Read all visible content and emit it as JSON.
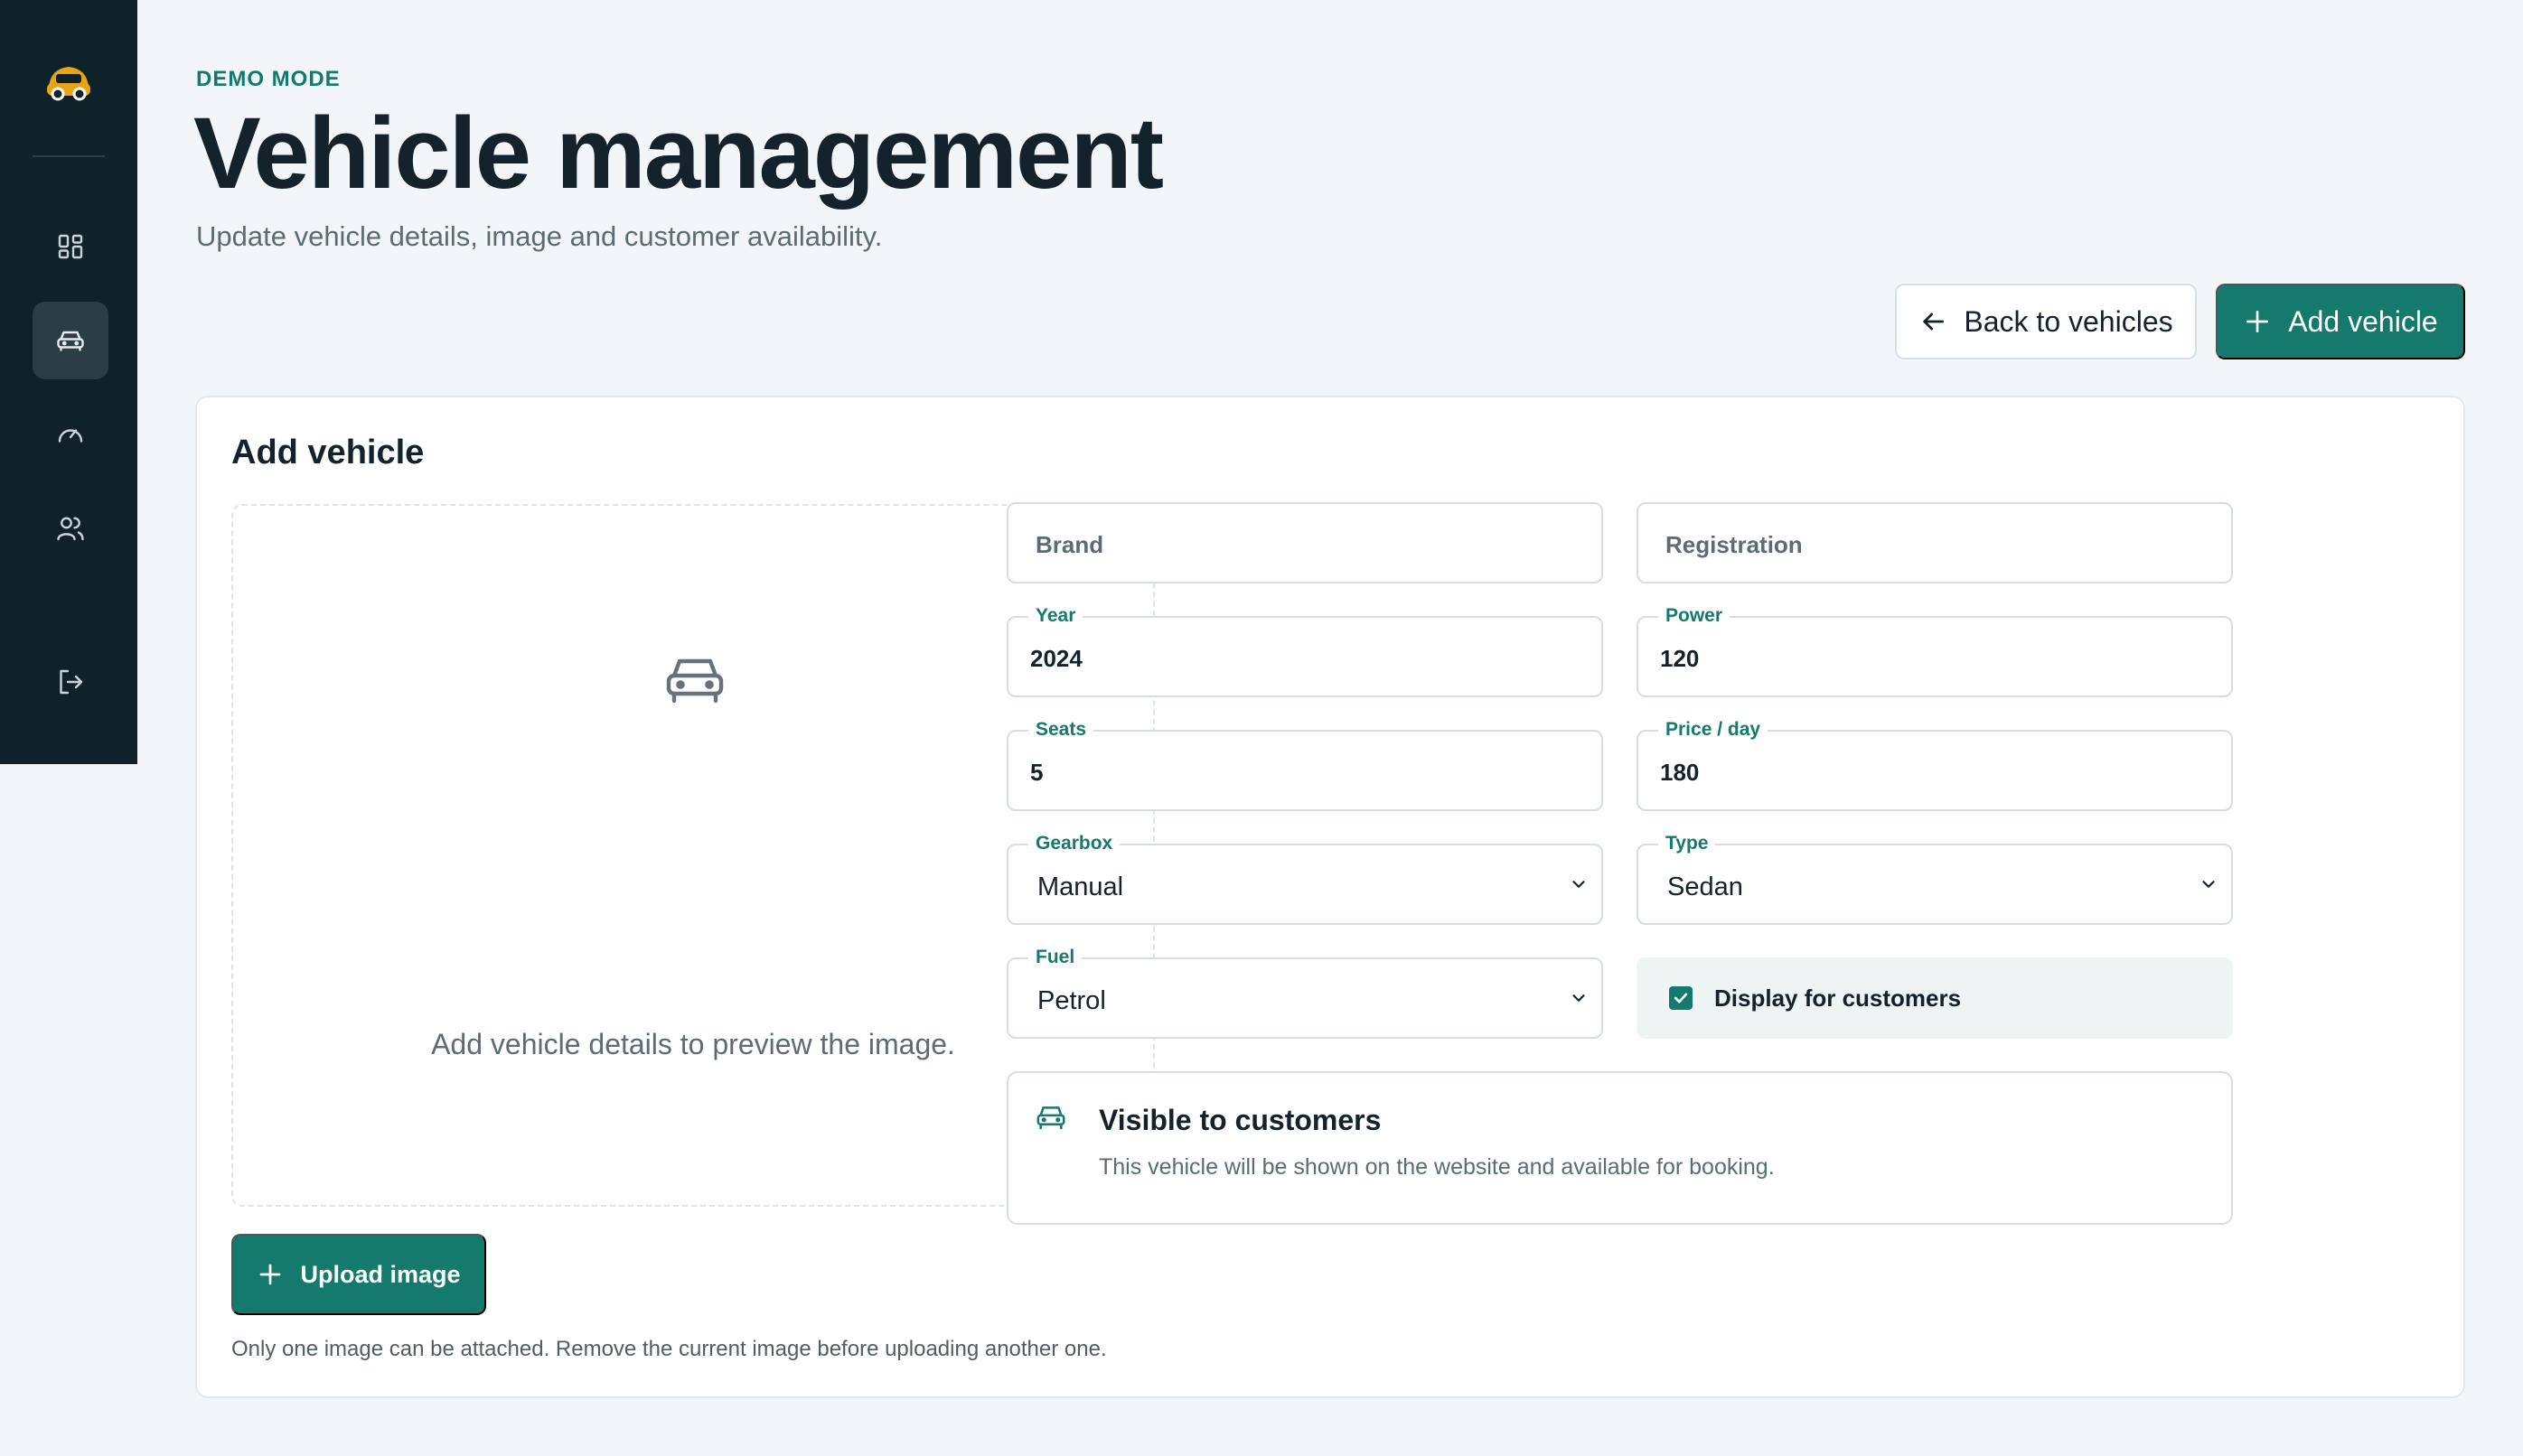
{
  "header": {
    "eyebrow": "DEMO MODE",
    "title": "Vehicle management",
    "subtitle": "Update vehicle details, image and customer availability."
  },
  "sidebar": {
    "items": [
      {
        "icon": "dashboard-icon",
        "active": false
      },
      {
        "icon": "car-icon",
        "active": true
      },
      {
        "icon": "gauge-icon",
        "active": false
      },
      {
        "icon": "users-icon",
        "active": false
      },
      {
        "icon": "logout-icon",
        "active": false
      }
    ]
  },
  "actions": {
    "back_label": "Back to vehicles",
    "add_label": "Add vehicle"
  },
  "form": {
    "title": "Add vehicle",
    "preview_text": "Add vehicle details to preview the image.",
    "upload_label": "Upload image",
    "upload_note": "Only one image can be attached. Remove the current image before uploading another one.",
    "brand": {
      "placeholder": "Brand",
      "value": ""
    },
    "registration": {
      "placeholder": "Registration",
      "value": ""
    },
    "year": {
      "label": "Year",
      "value": "2024"
    },
    "power": {
      "label": "Power",
      "value": "120"
    },
    "seats": {
      "label": "Seats",
      "value": "5"
    },
    "price": {
      "label": "Price / day",
      "value": "180"
    },
    "gearbox": {
      "label": "Gearbox",
      "value": "Manual"
    },
    "type": {
      "label": "Type",
      "value": "Sedan"
    },
    "fuel": {
      "label": "Fuel",
      "value": "Petrol"
    },
    "display_customers": {
      "label": "Display for customers",
      "checked": true
    },
    "visibility": {
      "title": "Visible to customers",
      "description": "This vehicle will be shown on the website and available for booking."
    }
  },
  "colors": {
    "accent": "#157a6e",
    "sidebar_bg": "#0f2229",
    "logo": "#e8a317"
  }
}
